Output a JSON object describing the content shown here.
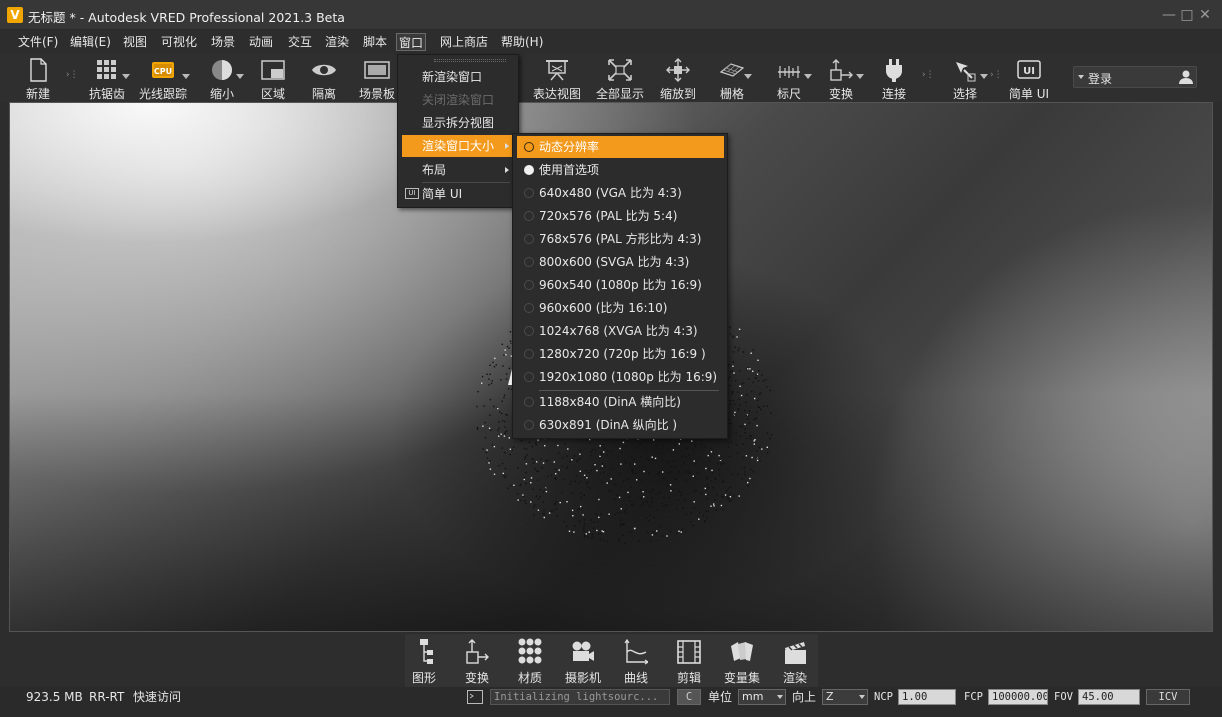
{
  "window": {
    "logo_text": "V",
    "title": "无标题 * - Autodesk VRED Professional 2021.3 Beta",
    "controls": [
      "—",
      "□",
      "✕"
    ]
  },
  "menubar": [
    "文件(F)",
    "编辑(E)",
    "视图",
    "可视化",
    "场景",
    "动画",
    "交互",
    "渲染",
    "脚本",
    "窗口",
    "网上商店",
    "帮助(H)"
  ],
  "toolbar": [
    {
      "label": "新建",
      "icon": "new-file-icon"
    },
    {
      "label": "抗锯齿",
      "icon": "antialias-grid-icon"
    },
    {
      "label": "光线跟踪",
      "icon": "cpu-raytracing-icon",
      "badge": "CPU"
    },
    {
      "label": "缩小",
      "icon": "scale-down-icon"
    },
    {
      "label": "区域",
      "icon": "region-icon"
    },
    {
      "label": "隔离",
      "icon": "isolate-eye-icon"
    },
    {
      "label": "场景板",
      "icon": "sceneplate-icon"
    },
    {
      "label": "表达视图",
      "icon": "presentation-icon"
    },
    {
      "label": "全部显示",
      "icon": "show-all-icon"
    },
    {
      "label": "缩放到",
      "icon": "zoom-to-icon"
    },
    {
      "label": "栅格",
      "icon": "grid-icon"
    },
    {
      "label": "标尺",
      "icon": "ruler-icon"
    },
    {
      "label": "变换",
      "icon": "transform-icon"
    },
    {
      "label": "连接",
      "icon": "connect-plug-icon"
    },
    {
      "label": "选择",
      "icon": "select-icon"
    },
    {
      "label": "简单 UI",
      "icon": "simple-ui-icon",
      "badge": "UI"
    }
  ],
  "login": {
    "label": "登录"
  },
  "window_menu": {
    "items": [
      {
        "label": "新渲染窗口",
        "state": "normal"
      },
      {
        "label": "关闭渲染窗口",
        "state": "disabled"
      },
      {
        "label": "显示拆分视图",
        "state": "normal"
      },
      {
        "label": "渲染窗口大小",
        "state": "highlight",
        "submenu": true
      },
      {
        "label": "布局",
        "state": "normal",
        "submenu": true
      },
      {
        "label": "简单 UI",
        "state": "normal",
        "badge": "UI"
      }
    ]
  },
  "render_size_submenu": {
    "items": [
      {
        "label": "动态分辨率",
        "state": "highlight",
        "checked": false
      },
      {
        "label": "使用首选项",
        "state": "normal",
        "checked": true
      },
      {
        "label": "640x480 (VGA 比为 4:3)",
        "state": "normal",
        "checked": false
      },
      {
        "label": "720x576 (PAL 比为 5:4)",
        "state": "normal",
        "checked": false
      },
      {
        "label": "768x576 (PAL 方形比为 4:3)",
        "state": "normal",
        "checked": false
      },
      {
        "label": "800x600 (SVGA 比为 4:3)",
        "state": "normal",
        "checked": false
      },
      {
        "label": "960x540 (1080p 比为 16:9)",
        "state": "normal",
        "checked": false
      },
      {
        "label": "960x600 (比为 16:10)",
        "state": "normal",
        "checked": false
      },
      {
        "label": "1024x768 (XVGA 比为 4:3)",
        "state": "normal",
        "checked": false
      },
      {
        "label": "1280x720 (720p 比为 16:9 )",
        "state": "normal",
        "checked": false
      },
      {
        "label": "1920x1080 (1080p 比为 16:9)",
        "state": "normal",
        "checked": false
      },
      {
        "label": "1188x840 (DinA 横向比)",
        "state": "normal",
        "checked": false
      },
      {
        "label": "630x891 (DinA 纵向比 )",
        "state": "normal",
        "checked": false
      }
    ]
  },
  "dock": [
    {
      "label": "图形",
      "icon": "scenegraph-icon"
    },
    {
      "label": "变换",
      "icon": "transform-dock-icon"
    },
    {
      "label": "材质",
      "icon": "materials-icon"
    },
    {
      "label": "摄影机",
      "icon": "camera-icon"
    },
    {
      "label": "曲线",
      "icon": "curves-icon"
    },
    {
      "label": "剪辑",
      "icon": "clip-film-icon"
    },
    {
      "label": "变量集",
      "icon": "variant-sets-icon"
    },
    {
      "label": "渲染",
      "icon": "render-clapper-icon"
    }
  ],
  "statusbar": {
    "memory": "923.5 MB",
    "mode": "RR-RT",
    "quick_access": "快速访问",
    "console_text": "Initializing lightsourc...",
    "c_button": "C",
    "unit_label": "单位",
    "unit_value": "mm",
    "up_label": "向上",
    "up_value": "Z",
    "ncp_label": "NCP",
    "ncp_value": "1.00",
    "fcp_label": "FCP",
    "fcp_value": "100000.00",
    "fov_label": "FOV",
    "fov_value": "45.00",
    "icv_label": "ICV"
  }
}
